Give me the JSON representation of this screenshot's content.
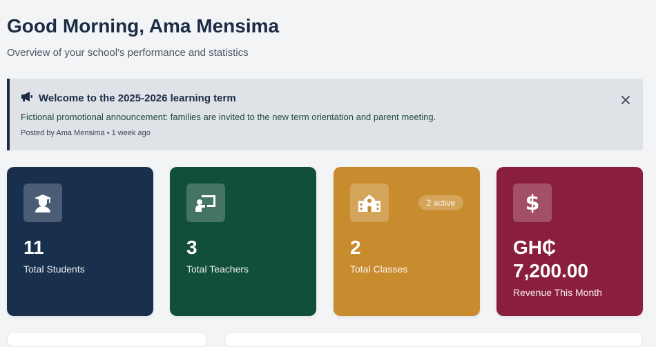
{
  "header": {
    "greeting": "Good Morning, Ama Mensima",
    "subtitle": "Overview of your school's performance and statistics"
  },
  "announcement": {
    "icon": "megaphone-icon",
    "title": "Welcome to the 2025-2026 learning term",
    "body": "Fictional promotional announcement: families are invited to the new term orientation and parent meeting.",
    "meta": "Posted by Ama Mensima • 1 week ago"
  },
  "stats": [
    {
      "icon": "graduate-icon",
      "value": "11",
      "label": "Total Students",
      "color": "#18304d"
    },
    {
      "icon": "teacher-board-icon",
      "value": "3",
      "label": "Total Teachers",
      "color": "#114e3b"
    },
    {
      "icon": "school-building-icon",
      "value": "2",
      "label": "Total Classes",
      "badge": "2 active",
      "color": "#c88b2e"
    },
    {
      "icon": "dollar-icon",
      "value_line1": "GH₵",
      "value_line2": "7,200.00",
      "label": "Revenue This Month",
      "color": "#8a1f3d"
    }
  ]
}
